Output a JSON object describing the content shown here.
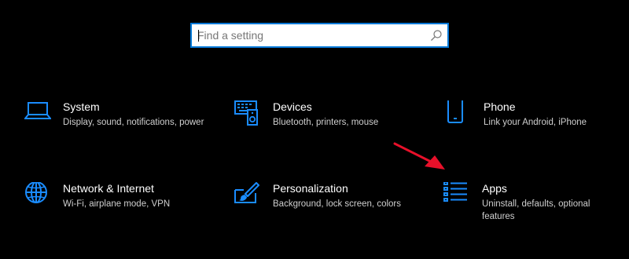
{
  "search": {
    "placeholder": "Find a setting",
    "value": ""
  },
  "colors": {
    "accent": "#0078d7",
    "icon": "#1a8cff",
    "background": "#000000",
    "arrow": "#e8102a"
  },
  "tiles": [
    {
      "title": "System",
      "description": "Display, sound, notifications, power",
      "icon": "laptop-icon"
    },
    {
      "title": "Devices",
      "description": "Bluetooth, printers, mouse",
      "icon": "keyboard-speaker-icon"
    },
    {
      "title": "Phone",
      "description": "Link your Android, iPhone",
      "icon": "phone-icon"
    },
    {
      "title": "Network & Internet",
      "description": "Wi-Fi, airplane mode, VPN",
      "icon": "globe-icon"
    },
    {
      "title": "Personalization",
      "description": "Background, lock screen, colors",
      "icon": "paintbrush-icon"
    },
    {
      "title": "Apps",
      "description": "Uninstall, defaults, optional features",
      "icon": "list-icon"
    }
  ]
}
